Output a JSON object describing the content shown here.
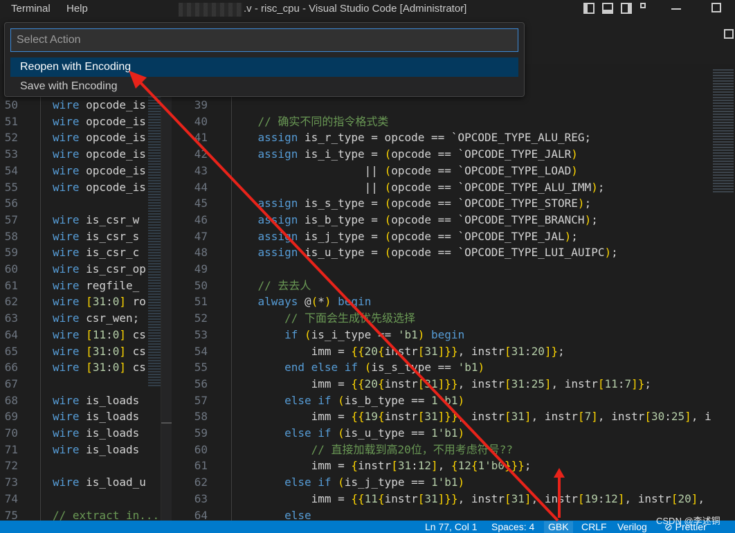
{
  "titlebar": {
    "menu_terminal": "Terminal",
    "menu_help": "Help",
    "title": ".v - risc_cpu - Visual Studio Code [Administrator]"
  },
  "palette": {
    "placeholder": "Select Action",
    "items": [
      "Reopen with Encoding",
      "Save with Encoding"
    ]
  },
  "left_editor": {
    "lines": [
      {
        "n": "50",
        "t": "wire opcode_is"
      },
      {
        "n": "51",
        "t": "wire opcode_is"
      },
      {
        "n": "52",
        "t": "wire opcode_is"
      },
      {
        "n": "53",
        "t": "wire opcode_is"
      },
      {
        "n": "54",
        "t": "wire opcode_is"
      },
      {
        "n": "55",
        "t": "wire opcode_is"
      },
      {
        "n": "56",
        "t": ""
      },
      {
        "n": "57",
        "t": "wire is_csr_w"
      },
      {
        "n": "58",
        "t": "wire is_csr_s"
      },
      {
        "n": "59",
        "t": "wire is_csr_c"
      },
      {
        "n": "60",
        "t": "wire is_csr_op"
      },
      {
        "n": "61",
        "t": "wire regfile_"
      },
      {
        "n": "62",
        "t": "wire [31:0] ro"
      },
      {
        "n": "63",
        "t": "wire csr_wen;"
      },
      {
        "n": "64",
        "t": "wire [11:0] cs"
      },
      {
        "n": "65",
        "t": "wire [31:0] cs"
      },
      {
        "n": "66",
        "t": "wire [31:0] cs"
      },
      {
        "n": "67",
        "t": ""
      },
      {
        "n": "68",
        "t": "wire is_loads"
      },
      {
        "n": "69",
        "t": "wire is_loads"
      },
      {
        "n": "70",
        "t": "wire is_loads"
      },
      {
        "n": "71",
        "t": "wire is_loads"
      },
      {
        "n": "72",
        "t": ""
      },
      {
        "n": "73",
        "t": "wire is_load_u"
      },
      {
        "n": "74",
        "t": ""
      },
      {
        "n": "75",
        "t": "// extract in..."
      }
    ]
  },
  "right_editor": {
    "lines": [
      {
        "n": "39",
        "t": ""
      },
      {
        "n": "40",
        "t": "    // 确实不同的指令格式类"
      },
      {
        "n": "41",
        "t": "    assign is_r_type = opcode == `OPCODE_TYPE_ALU_REG;"
      },
      {
        "n": "42",
        "t": "    assign is_i_type = (opcode == `OPCODE_TYPE_JALR)"
      },
      {
        "n": "43",
        "t": "                    || (opcode == `OPCODE_TYPE_LOAD)"
      },
      {
        "n": "44",
        "t": "                    || (opcode == `OPCODE_TYPE_ALU_IMM);"
      },
      {
        "n": "45",
        "t": "    assign is_s_type = (opcode == `OPCODE_TYPE_STORE);"
      },
      {
        "n": "46",
        "t": "    assign is_b_type = (opcode == `OPCODE_TYPE_BRANCH);"
      },
      {
        "n": "47",
        "t": "    assign is_j_type = (opcode == `OPCODE_TYPE_JAL);"
      },
      {
        "n": "48",
        "t": "    assign is_u_type = (opcode == `OPCODE_TYPE_LUI_AUIPC);"
      },
      {
        "n": "49",
        "t": ""
      },
      {
        "n": "50",
        "t": "    // 去去人"
      },
      {
        "n": "51",
        "t": "    always @(*) begin"
      },
      {
        "n": "52",
        "t": "        // 下面会生成优先级选择"
      },
      {
        "n": "53",
        "t": "        if (is_i_type == 'b1) begin"
      },
      {
        "n": "54",
        "t": "            imm = {{20{instr[31]}}, instr[31:20]};"
      },
      {
        "n": "55",
        "t": "        end else if (is_s_type == 'b1)"
      },
      {
        "n": "56",
        "t": "            imm = {{20{instr[31]}}, instr[31:25], instr[11:7]};"
      },
      {
        "n": "57",
        "t": "        else if (is_b_type == 1'b1)"
      },
      {
        "n": "58",
        "t": "            imm = {{19{instr[31]}}, instr[31], instr[7], instr[30:25], i"
      },
      {
        "n": "59",
        "t": "        else if (is_u_type == 1'b1)"
      },
      {
        "n": "60",
        "t": "            // 直接加载到高20位，不用考虑符号??"
      },
      {
        "n": "61",
        "t": "            imm = {instr[31:12], {12{1'b0}}};"
      },
      {
        "n": "62",
        "t": "        else if (is_j_type == 1'b1)"
      },
      {
        "n": "63",
        "t": "            imm = {{11{instr[31]}}, instr[31], instr[19:12], instr[20],"
      },
      {
        "n": "64",
        "t": "        else"
      }
    ]
  },
  "statusbar": {
    "position": "Ln 77, Col 1",
    "spaces": "Spaces: 4",
    "encoding": "GBK",
    "eol": "CRLF",
    "language": "Verilog",
    "prettier": "Prettier"
  },
  "watermark": "CSDN @李述铜",
  "colors": {
    "accent": "#007acc",
    "annotation_arrow": "#e8231a",
    "selection": "#04395e"
  }
}
